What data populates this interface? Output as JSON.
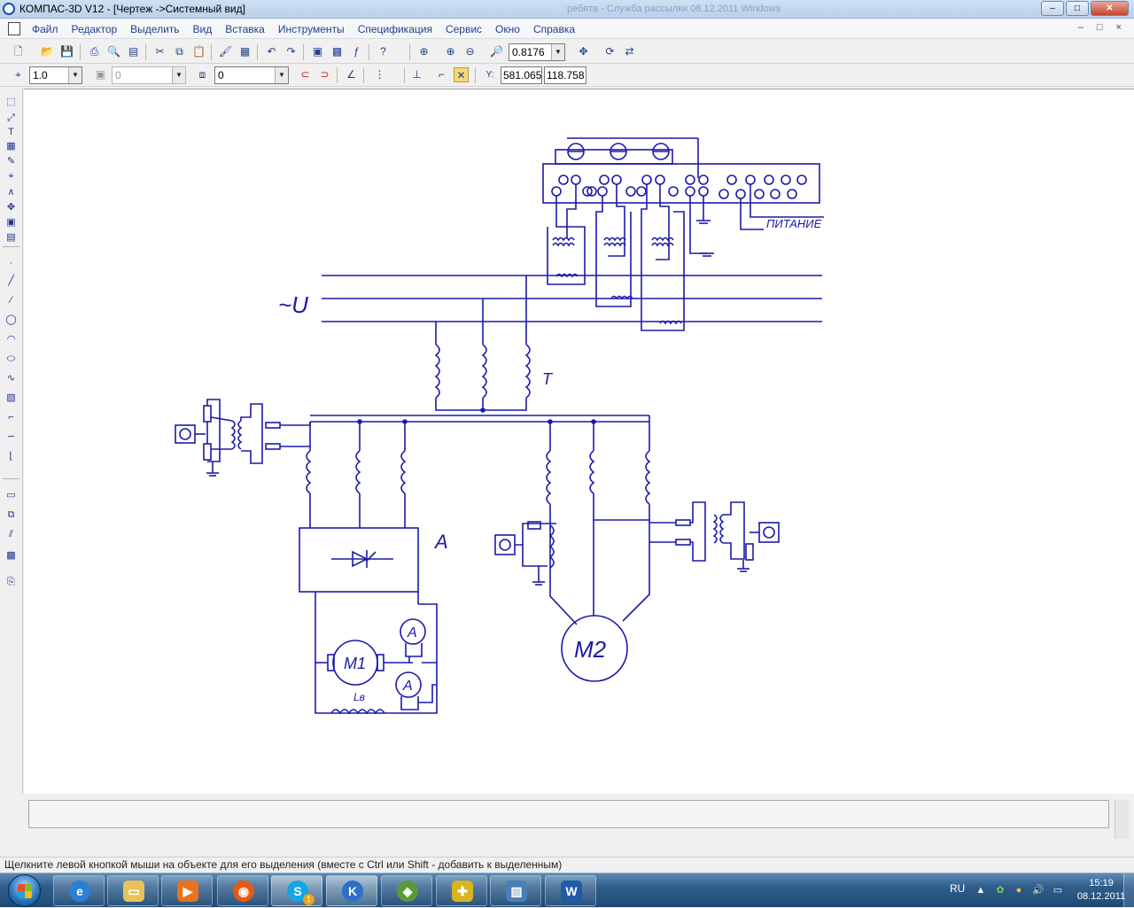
{
  "window": {
    "title": "КОМПАС-3D V12 - [Чертеж ->Системный вид]",
    "background_title_fragment": "ребята - Служба рассылки 08.12.2011 Windows",
    "buttons": {
      "minimize": "–",
      "maximize": "□",
      "close": "✕"
    }
  },
  "menu": {
    "items": [
      "Файл",
      "Редактор",
      "Выделить",
      "Вид",
      "Вставка",
      "Инструменты",
      "Спецификация",
      "Сервис",
      "Окно",
      "Справка"
    ],
    "doc_controls": "– □ ×"
  },
  "toolbar_standard": {
    "zoom_value": "0.8176"
  },
  "toolbar_current_state": {
    "step_value": "1.0",
    "layer_value": "0",
    "style_value": "0",
    "cursor_x": "581.065",
    "cursor_y": "118.758",
    "y_label": "Y:"
  },
  "drawing": {
    "labels": {
      "supply": "~U",
      "transformer": "T",
      "converter": "A",
      "motor1": "M1",
      "motor2": "M2",
      "ammeter1": "A",
      "ammeter2": "A",
      "field_winding": "Lв",
      "power": "ПИТАНИЕ"
    },
    "terminal_signs": [
      "⊖",
      "⊖",
      "⊕",
      "⊕",
      "⊕",
      "⊕",
      "⊖",
      "⊖",
      "⊖",
      "⊖",
      "⊖"
    ]
  },
  "status_bar": {
    "hint": "Щелкните левой кнопкой мыши на объекте для его выделения (вместе с Ctrl или Shift - добавить к выделенным)"
  },
  "taskbar": {
    "language": "RU",
    "time": "15:19",
    "date": "08.12.2011",
    "apps": [
      "internet-explorer",
      "file-explorer",
      "media-player",
      "firefox",
      "skype",
      "kompas",
      "gadget",
      "sketch-app",
      "image-viewer",
      "word"
    ],
    "skype_badge": "1"
  },
  "colors": {
    "drawing_lines": "#1a1aa8",
    "canvas_bg": "#ffffff",
    "taskbar": "#2f5d8a"
  }
}
